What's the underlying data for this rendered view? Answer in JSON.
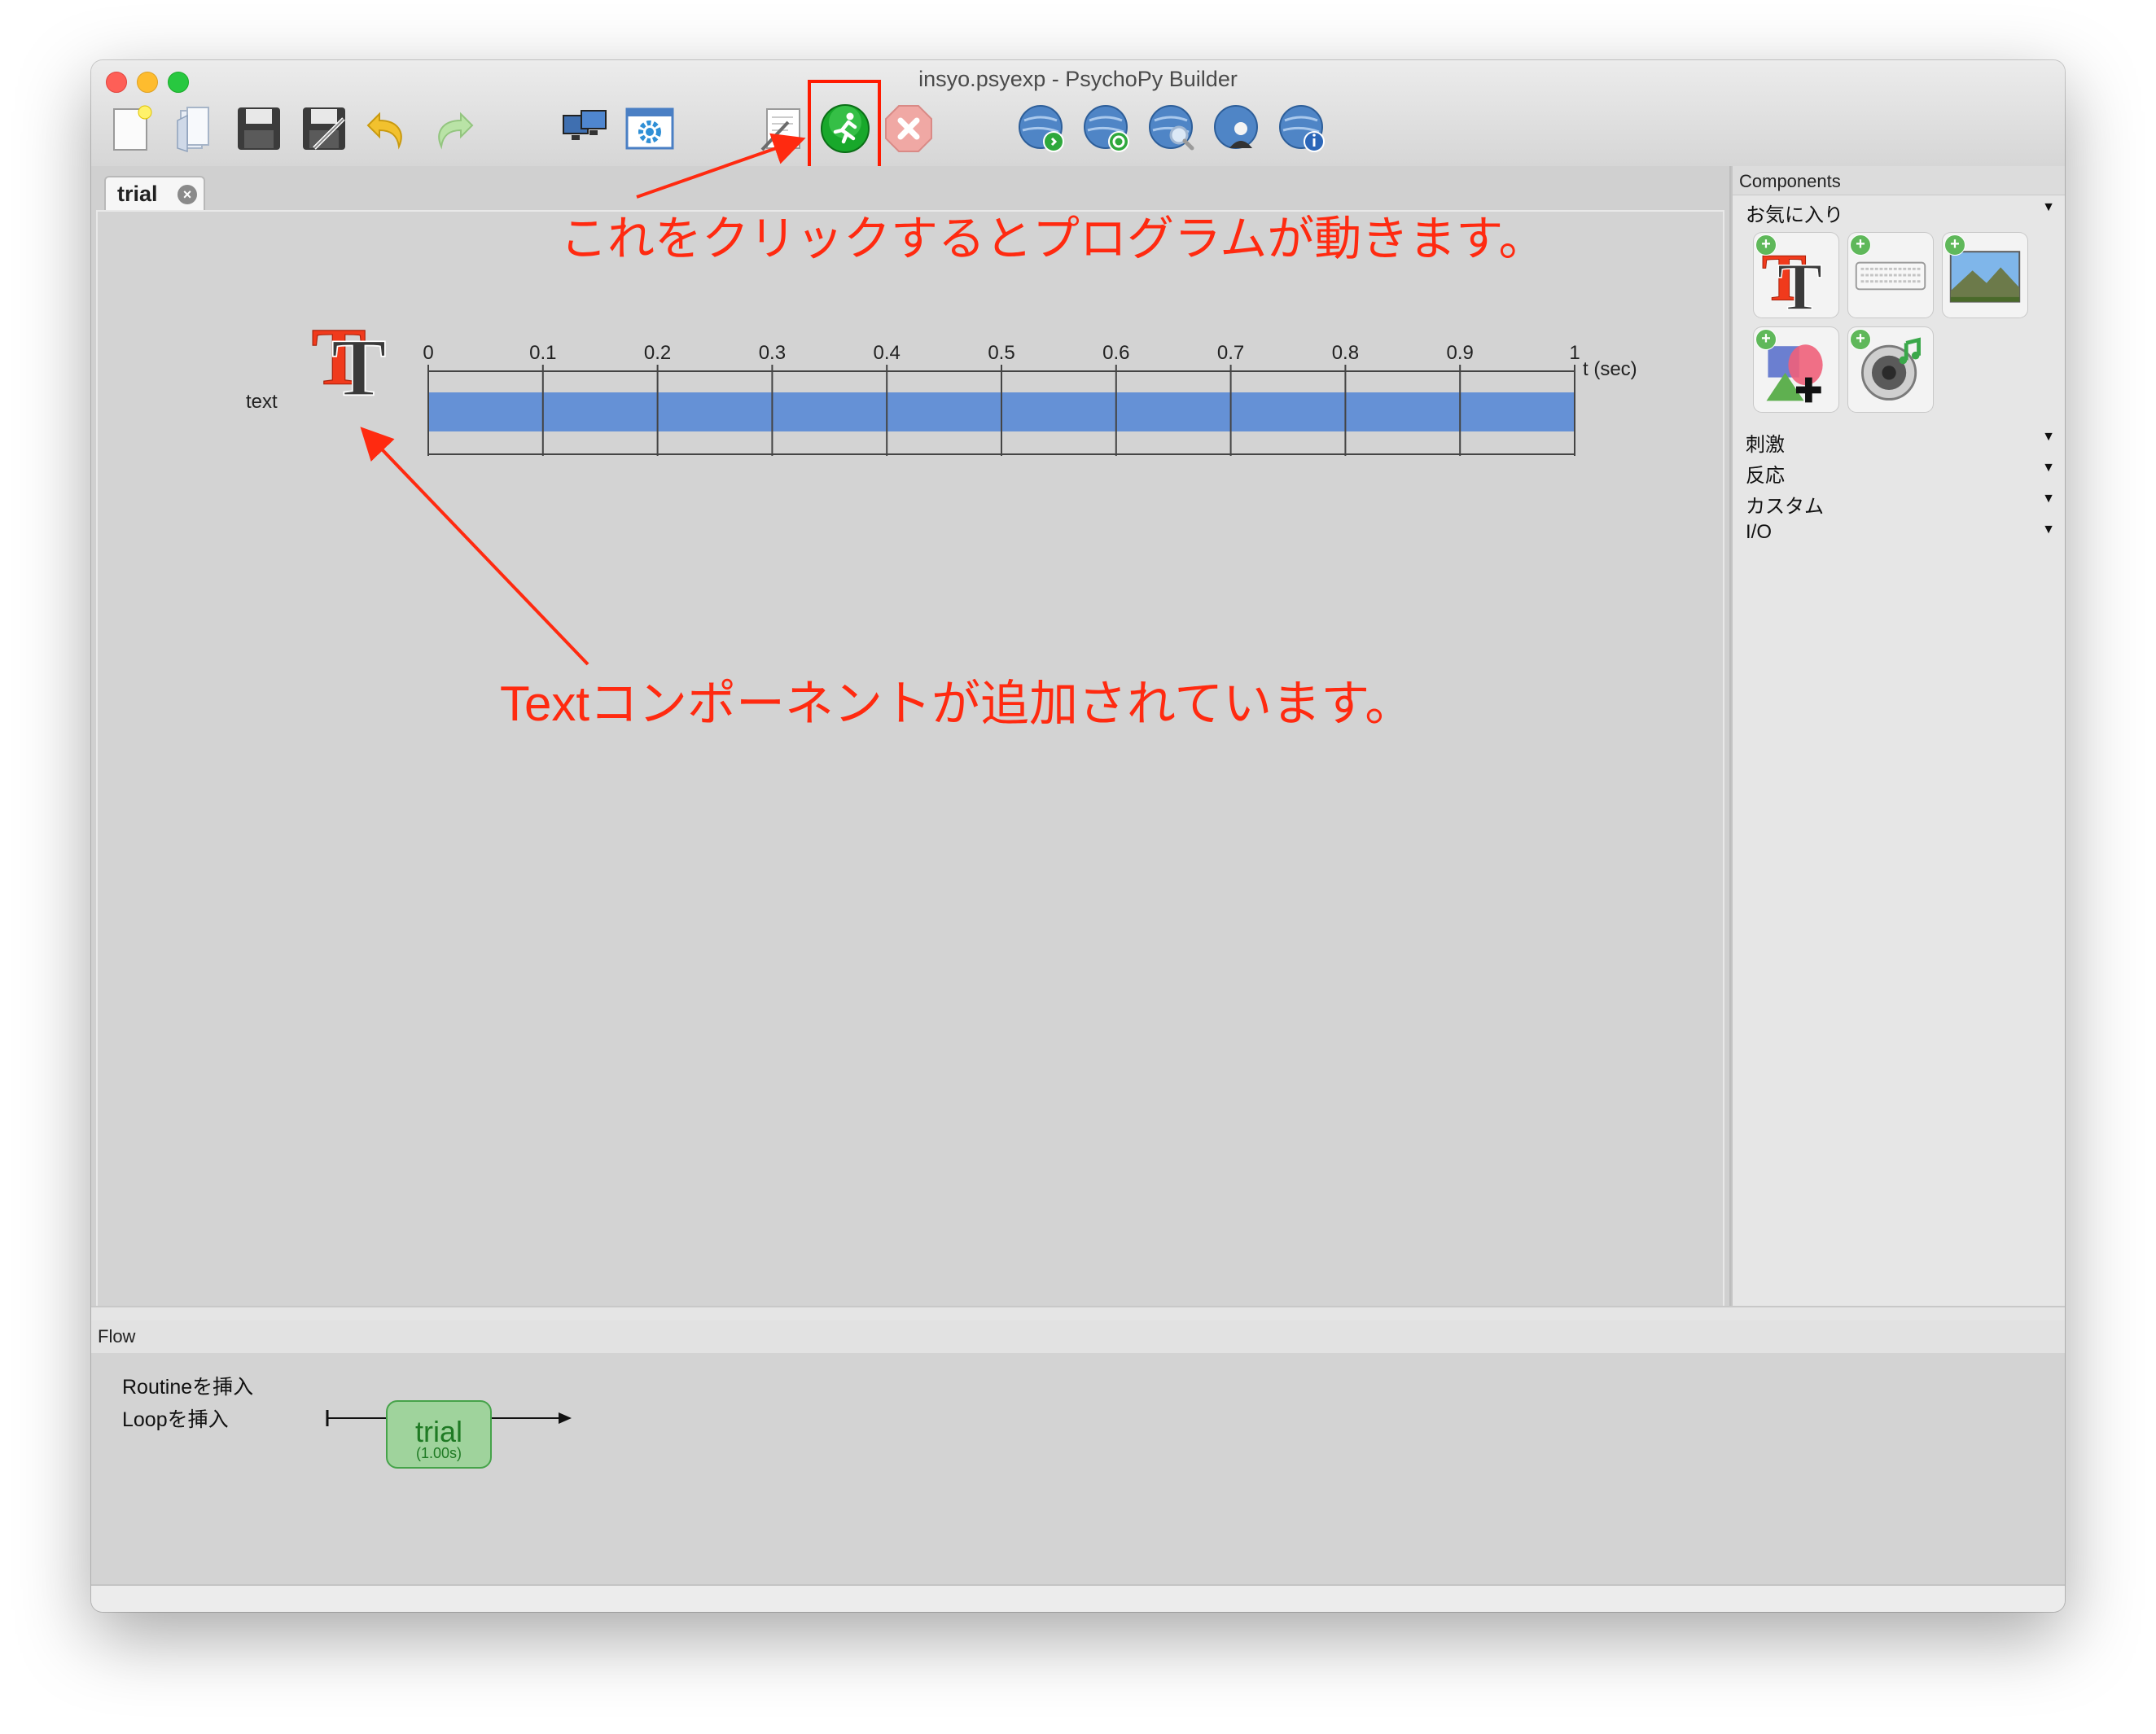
{
  "window": {
    "title": "insyo.psyexp - PsychoPy Builder"
  },
  "toolbar": {
    "items": [
      {
        "name": "new-file-icon"
      },
      {
        "name": "open-file-icon"
      },
      {
        "name": "save-icon"
      },
      {
        "name": "save-as-icon"
      },
      {
        "name": "undo-icon"
      },
      {
        "name": "redo-icon"
      },
      {
        "name": "monitor-center-icon"
      },
      {
        "name": "experiment-settings-icon"
      },
      {
        "name": "compile-script-icon"
      },
      {
        "name": "run-icon"
      },
      {
        "name": "stop-icon"
      },
      {
        "name": "pavlovia-sync-icon"
      },
      {
        "name": "pavlovia-refresh-icon"
      },
      {
        "name": "pavlovia-search-icon"
      },
      {
        "name": "pavlovia-user-icon"
      },
      {
        "name": "pavlovia-info-icon"
      }
    ]
  },
  "routine": {
    "tab_label": "trial",
    "component_name": "text",
    "timeline": {
      "ticks": [
        "0",
        "0.1",
        "0.2",
        "0.3",
        "0.4",
        "0.5",
        "0.6",
        "0.7",
        "0.8",
        "0.9",
        "1"
      ],
      "unit_label": "t (sec)",
      "bar_start": 0,
      "bar_end": 1,
      "bar_color": "#6591d6"
    }
  },
  "components": {
    "header": "Components",
    "categories": [
      {
        "label": "お気に入り"
      },
      {
        "label": "刺激"
      },
      {
        "label": "反応"
      },
      {
        "label": "カスタム"
      },
      {
        "label": "I/O"
      }
    ],
    "favorites": [
      {
        "name": "text-component-icon"
      },
      {
        "name": "keyboard-component-icon"
      },
      {
        "name": "image-component-icon"
      },
      {
        "name": "polygon-component-icon"
      },
      {
        "name": "sound-component-icon"
      }
    ]
  },
  "flow": {
    "header": "Flow",
    "insert_routine": "Routineを挿入",
    "insert_loop": "Loopを挿入",
    "routine_name": "trial",
    "routine_duration": "(1.00s)"
  },
  "annotations": {
    "run_note": "これをクリックするとプログラムが動きます。",
    "text_note": "Textコンポーネントが追加されています。",
    "color": "#ff2a10"
  }
}
